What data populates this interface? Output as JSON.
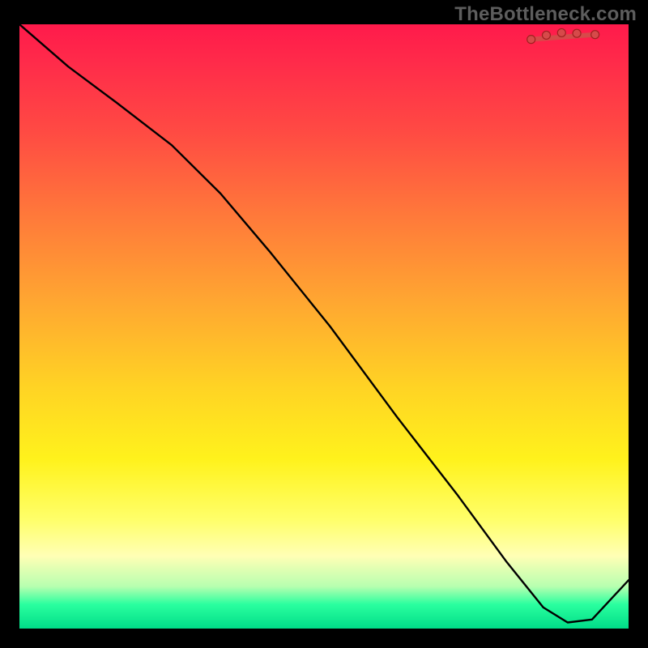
{
  "watermark": "TheBottleneck.com",
  "chart_data": {
    "type": "line",
    "title": "",
    "xlabel": "",
    "ylabel": "",
    "xlim": [
      0,
      100
    ],
    "ylim": [
      0,
      100
    ],
    "grid": false,
    "legend": false,
    "series": [
      {
        "name": "curve",
        "x": [
          0,
          8,
          16,
          25,
          33,
          41,
          51,
          62,
          72,
          80,
          86,
          90,
          94,
          100
        ],
        "values": [
          100,
          93,
          87,
          80,
          72,
          62.5,
          50,
          35,
          22,
          11,
          3.5,
          1,
          1.5,
          8
        ]
      }
    ],
    "highlight": {
      "x_start": 84,
      "x_end": 95,
      "dot_x": [
        84,
        86.5,
        89,
        91.5,
        94.5
      ],
      "dot_y": [
        97.5,
        98.2,
        98.6,
        98.5,
        98.3
      ]
    }
  },
  "colors": {
    "frame": "#000000",
    "watermark": "#5d5d5d",
    "curve": "#000000",
    "highlight": "#d64a4a"
  }
}
